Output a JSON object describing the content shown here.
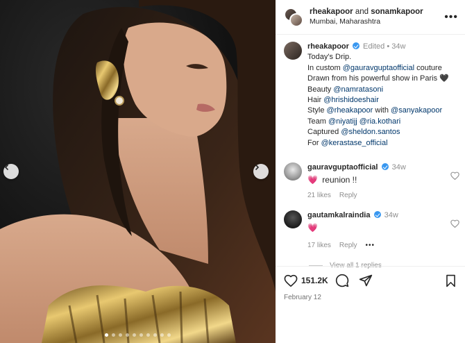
{
  "post": {
    "header": {
      "user1": "rheakapoor",
      "joiner": "and",
      "user2": "sonamkapoor",
      "location": "Mumbai, Maharashtra"
    },
    "caption": {
      "username": "rheakapoor",
      "edited": "Edited",
      "sep": "•",
      "age": "34w",
      "lines": [
        [
          {
            "t": "Today's Drip."
          }
        ],
        [
          {
            "t": "In custom "
          },
          {
            "m": "@gauravguptaofficial"
          },
          {
            "t": " couture"
          }
        ],
        [
          {
            "t": "Drawn from his powerful show in Paris "
          },
          {
            "e": "🖤"
          }
        ],
        [
          {
            "t": "Beauty "
          },
          {
            "m": "@namratasoni"
          }
        ],
        [
          {
            "t": "Hair "
          },
          {
            "m": "@hrishidoeshair"
          }
        ],
        [
          {
            "t": "Style "
          },
          {
            "m": "@rheakapoor"
          },
          {
            "t": " with "
          },
          {
            "m": "@sanyakapoor"
          }
        ],
        [
          {
            "t": "Team "
          },
          {
            "m": "@niyatijj"
          },
          {
            "t": " "
          },
          {
            "m": "@ria.kothari"
          }
        ],
        [
          {
            "t": "Captured "
          },
          {
            "m": "@sheldon.santos"
          }
        ],
        [
          {
            "t": "For "
          },
          {
            "m": "@kerastase_official"
          }
        ]
      ]
    },
    "comments": [
      {
        "username": "gauravguptaofficial",
        "age": "34w",
        "emoji": "💗",
        "text": "reunion !!",
        "likes": "21 likes",
        "reply": "Reply"
      },
      {
        "username": "gautamkalraindia",
        "age": "34w",
        "emoji": "💗",
        "text": "",
        "likes": "17 likes",
        "reply": "Reply",
        "more": "•••",
        "view_replies": "View all 1 replies"
      }
    ],
    "actions": {
      "like_count": "151.2K",
      "date": "February 12"
    },
    "carousel": {
      "dot_count": 10,
      "active_dot": 0
    }
  }
}
